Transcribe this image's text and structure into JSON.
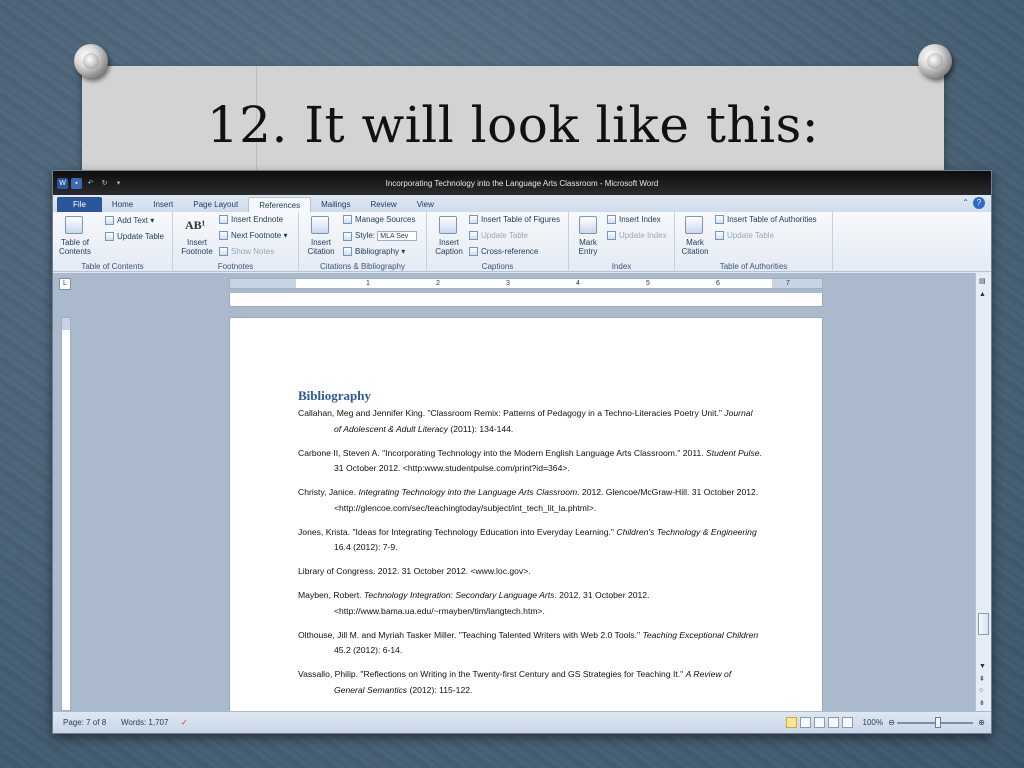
{
  "slide": {
    "title": "12. It will look like this:"
  },
  "window": {
    "title": "Incorporating Technology into the Language Arts Classroom - Microsoft Word",
    "app_icon": "word-icon"
  },
  "tabs": [
    "File",
    "Home",
    "Insert",
    "Page Layout",
    "References",
    "Mailings",
    "Review",
    "View"
  ],
  "active_tab": "References",
  "ribbon": {
    "toc": {
      "button": "Table of Contents",
      "add_text": "Add Text",
      "update_table": "Update Table",
      "label": "Table of Contents"
    },
    "footnotes": {
      "insert_footnote": "Insert Footnote",
      "insert_endnote": "Insert Endnote",
      "next_footnote": "Next Footnote",
      "show_notes": "Show Notes",
      "label": "Footnotes"
    },
    "citations": {
      "insert_citation": "Insert Citation",
      "manage_sources": "Manage Sources",
      "style_label": "Style:",
      "style_value": "MLA Sev",
      "bibliography": "Bibliography",
      "label": "Citations & Bibliography"
    },
    "captions": {
      "insert_caption": "Insert Caption",
      "insert_table_of_figures": "Insert Table of Figures",
      "update_table": "Update Table",
      "cross_reference": "Cross-reference",
      "label": "Captions"
    },
    "index": {
      "mark_entry": "Mark Entry",
      "insert_index": "Insert Index",
      "update_index": "Update Index",
      "label": "Index"
    },
    "authorities": {
      "mark_citation": "Mark Citation",
      "insert_table_of_authorities": "Insert Table of Authorities",
      "update_table": "Update Table",
      "label": "Table of Authorities"
    }
  },
  "ruler": {
    "numbers": [
      "1",
      "2",
      "3",
      "4",
      "5",
      "6",
      "7"
    ]
  },
  "document": {
    "heading": "Bibliography",
    "references": [
      {
        "pre": "Callahan, Meg and Jennifer King. \"Classroom Remix: Patterns of Pedagogy in a Techno-Literacies Poetry Unit.\" ",
        "ital": "Journal of Adolescent & Adult Literacy",
        "post": " (2011): 134-144."
      },
      {
        "pre": "Carbone II, Steven A. \"Incorporating Technology into the Modern English Language Arts Classroom.\" 2011. ",
        "ital": "Student Pulse",
        "post": ". 31 October 2012. <http:www.studentpulse.com/print?id=364>."
      },
      {
        "pre": "Christy, Janice. ",
        "ital": "Integrating Technology into the Language Arts Classroom",
        "post": ". 2012. Glencoe/McGraw-Hill. 31 October 2012. <http://glencoe.com/sec/teachingtoday/subject/int_tech_lit_la.phtml>."
      },
      {
        "pre": "Jones, Krista. \"Ideas for Integrating Technology Education into Everyday Learning.\" ",
        "ital": "Children's Technology & Engineering",
        "post": " 16.4 (2012): 7-9."
      },
      {
        "pre": "Library of Congress. 2012. 31 October 2012. <www.loc.gov>.",
        "ital": "",
        "post": ""
      },
      {
        "pre": "Mayben, Robert. ",
        "ital": "Technology Integration: Secondary Language Arts",
        "post": ". 2012. 31 October 2012. <http://www.bama.ua.edu/~rmayben/tim/langtech.htm>."
      },
      {
        "pre": "Olthouse, Jill M. and Myriah Tasker Miller. \"Teaching Talented Writers with Web 2.0 Tools.\" ",
        "ital": "Teaching Exceptional Children",
        "post": " 45.2 (2012): 6-14."
      },
      {
        "pre": "Vassallo, Philip. \"Reflections on Writing in the Twenty-first Century and GS Strategies for Teaching It.\" ",
        "ital": "A Review of General Semantics",
        "post": " (2012): 115-122."
      }
    ]
  },
  "status": {
    "page": "Page: 7 of 8",
    "words": "Words: 1,707",
    "zoom": "100%"
  }
}
